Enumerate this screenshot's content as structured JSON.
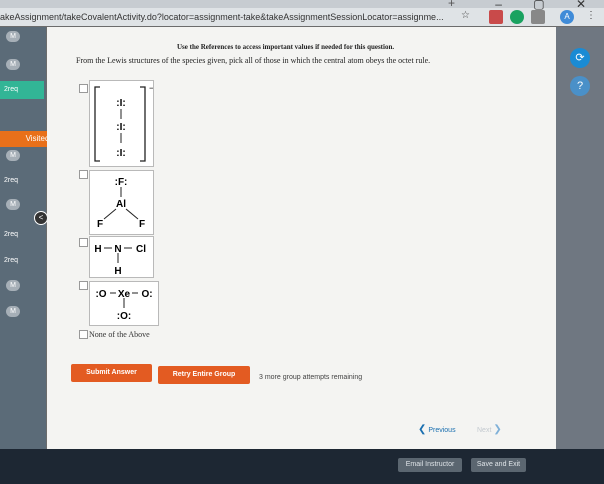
{
  "browser": {
    "url": "akeAssignment/takeCovalentActivity.do?locator=assignment-take&takeAssignmentSessionLocator=assignme...",
    "new_tab": "+",
    "window_controls": "– ▢ ✕",
    "star_icon": "star-icon",
    "avatar_letter": "A",
    "menu_icon": "⋮"
  },
  "sidebar": {
    "items": [
      {
        "type": "m",
        "label": "M"
      },
      {
        "type": "m",
        "label": "M"
      },
      {
        "type": "req",
        "label": "2req"
      },
      {
        "type": "m",
        "label": "M"
      },
      {
        "type": "req",
        "label": "2req"
      },
      {
        "type": "m",
        "label": "M"
      },
      {
        "type": "req",
        "label": "2req"
      },
      {
        "type": "req",
        "label": "2req"
      },
      {
        "type": "m",
        "label": "M"
      },
      {
        "type": "m",
        "label": "M"
      }
    ],
    "visited_label": "Visited",
    "collapse_label": "<"
  },
  "question": {
    "references": "Use the References to access important values if needed for this question.",
    "prompt": "From the Lewis structures of the species given, pick all of those in which the central atom obeys the octet rule.",
    "options": [
      {
        "id": "I3-",
        "atoms": [
          ":I:",
          ":I:",
          ":I:"
        ],
        "charge": "−"
      },
      {
        "id": "AlF3",
        "atoms": [
          ":F:",
          "Al",
          "F",
          "F"
        ]
      },
      {
        "id": "NHCl",
        "atoms": [
          "H",
          "N",
          "Cl",
          "H"
        ]
      },
      {
        "id": "XeO3",
        "atoms": [
          ":O",
          "Xe",
          "O:",
          ":O:"
        ]
      }
    ],
    "none_label": "None of the Above"
  },
  "actions": {
    "submit": "Submit Answer",
    "retry": "Retry Entire Group",
    "attempts": "3 more group attempts remaining",
    "previous": "Previous",
    "next": "Next",
    "email": "Email Instructor",
    "save_exit": "Save and Exit"
  },
  "colors": {
    "accent_orange": "#e35b22",
    "sidebar_green": "#32b596",
    "help_blue": "#1a8bd4"
  }
}
